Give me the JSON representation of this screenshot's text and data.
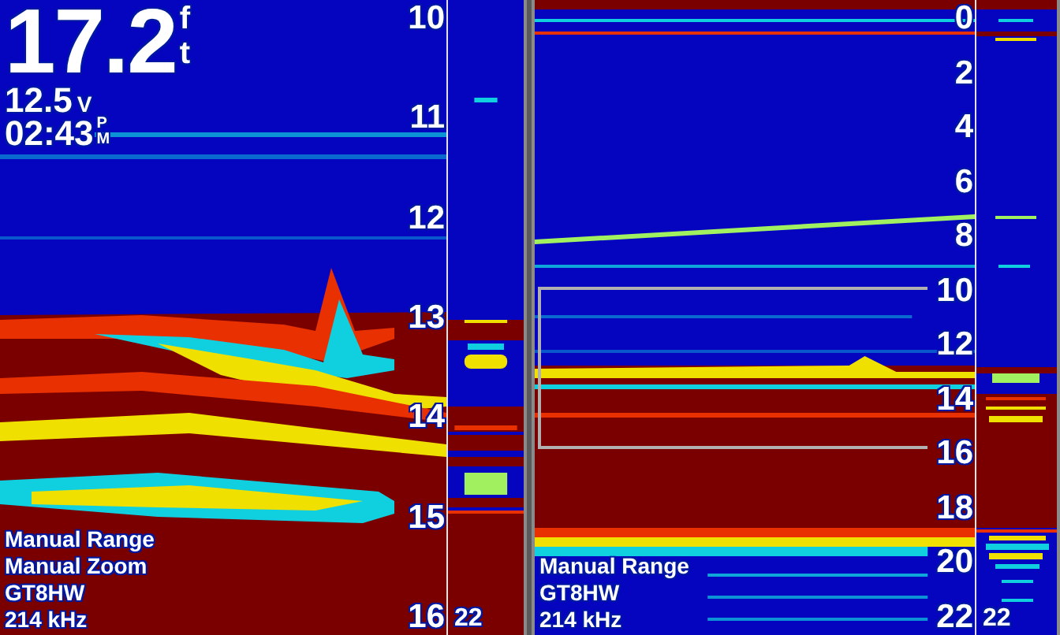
{
  "left_pane": {
    "depth_reading": {
      "value": "17.2",
      "unit": [
        "f",
        "t"
      ]
    },
    "voltage": {
      "value": "12.5",
      "unit": "V"
    },
    "time": {
      "value": "02:43",
      "suffix": [
        "P",
        "M"
      ]
    },
    "scale": [
      "10",
      "11",
      "12",
      "13",
      "14",
      "15",
      "16"
    ],
    "labels": [
      "Manual Range",
      "Manual Zoom",
      "GT8HW",
      "214 kHz"
    ],
    "flasher_depth": "22"
  },
  "right_pane": {
    "scale": [
      "0",
      "2",
      "4",
      "6",
      "8",
      "10",
      "12",
      "14",
      "16",
      "18",
      "20",
      "22"
    ],
    "labels": [
      "Manual Range",
      "GT8HW",
      "214 kHz"
    ],
    "flasher_depth": "22"
  }
}
